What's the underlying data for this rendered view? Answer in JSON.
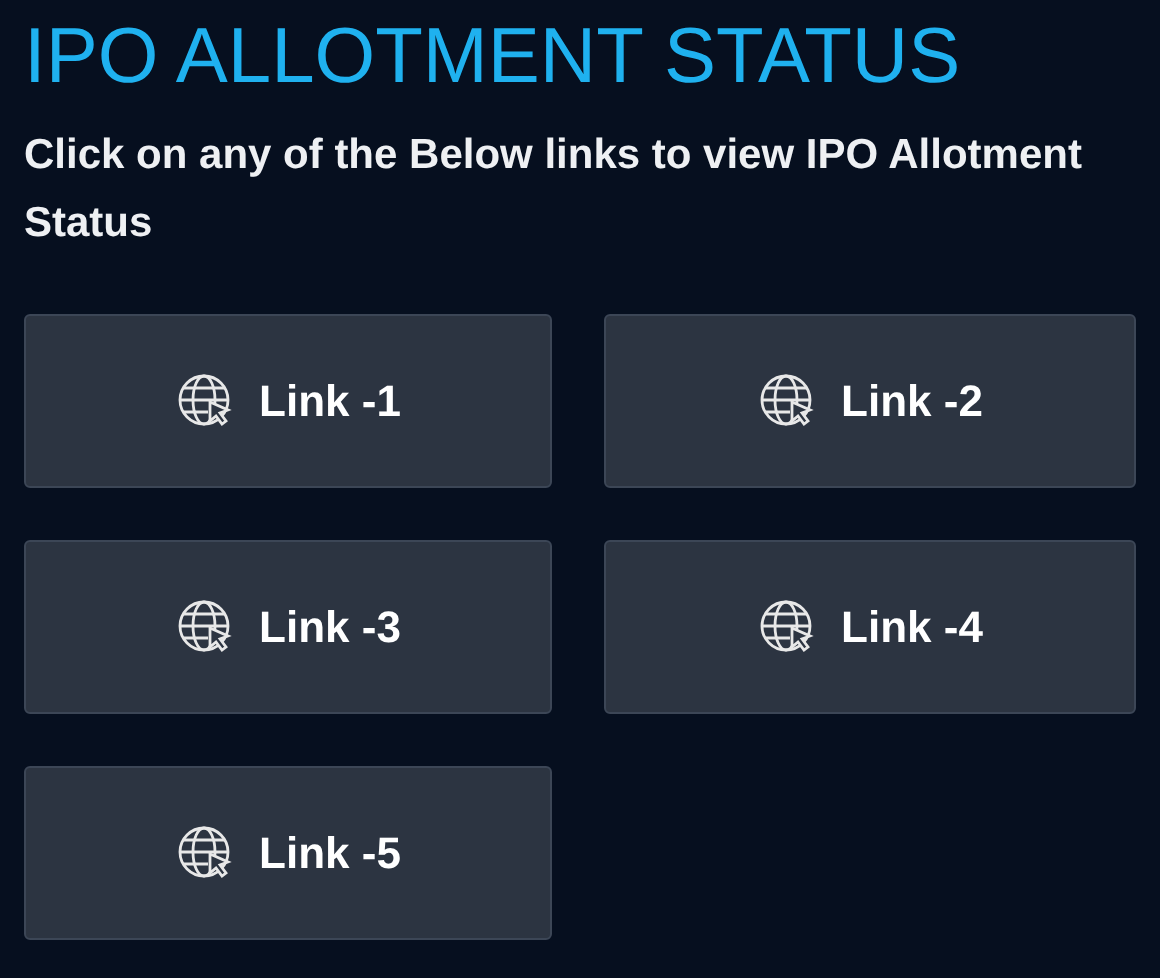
{
  "title": "IPO ALLOTMENT STATUS",
  "subtitle": "Click on any of the Below links to view IPO Allotment Status",
  "links": [
    {
      "label": "Link -1"
    },
    {
      "label": "Link -2"
    },
    {
      "label": "Link -3"
    },
    {
      "label": "Link -4"
    },
    {
      "label": "Link -5"
    }
  ]
}
